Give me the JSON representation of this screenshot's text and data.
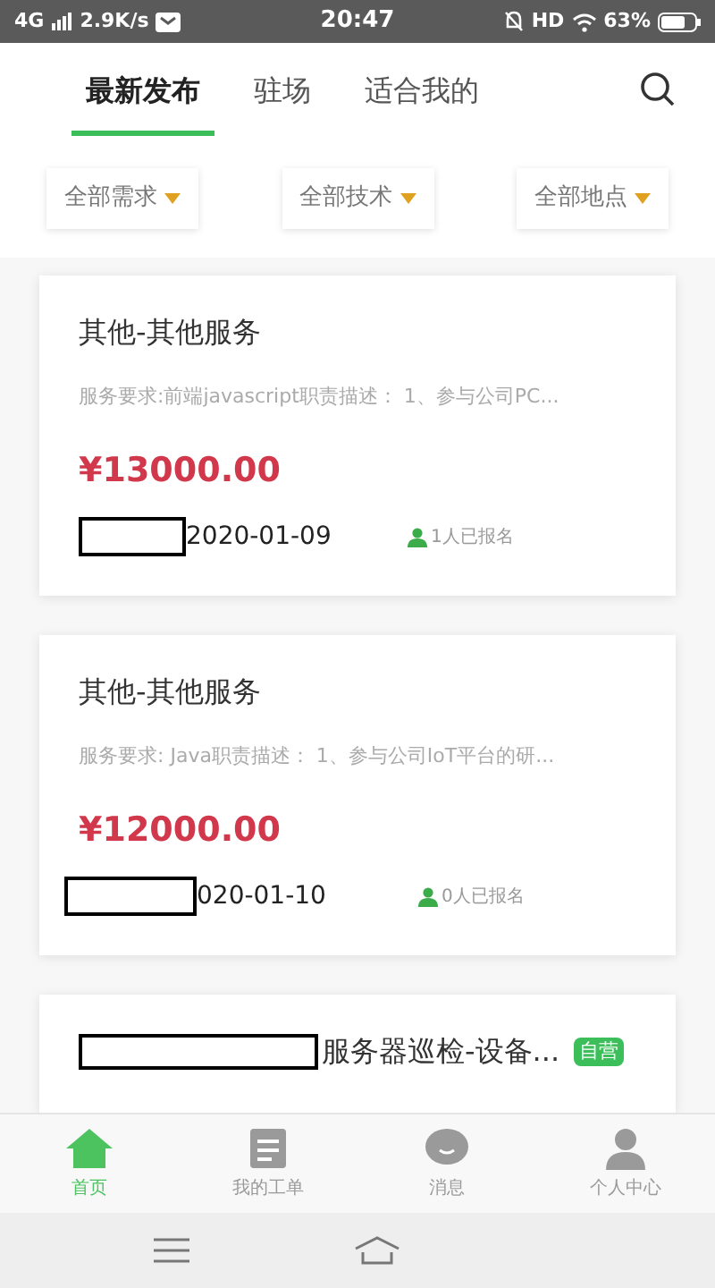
{
  "status_bar": {
    "network": "4G",
    "speed": "2.9K/s",
    "time": "20:47",
    "hd": "HD",
    "battery": "63%"
  },
  "tabs": [
    {
      "label": "最新发布",
      "selected": true
    },
    {
      "label": "驻场",
      "selected": false
    },
    {
      "label": "适合我的",
      "selected": false
    }
  ],
  "filters": [
    "全部需求",
    "全部技术",
    "全部地点"
  ],
  "cards": [
    {
      "title": "其他-其他服务",
      "description": "服务要求:前端javascript职责描述： 1、参与公司PC...",
      "price": "¥13000.00",
      "date": "2020-01-09",
      "signups": "1人已报名"
    },
    {
      "title": "其他-其他服务",
      "description": "服务要求: Java职责描述： 1、参与公司IoT平台的研...",
      "price": "¥12000.00",
      "date": "020-01-10",
      "signups": "0人已报名"
    },
    {
      "title": "服务器巡检-设备...",
      "badge": "自营"
    }
  ],
  "bottom_nav": [
    {
      "label": "首页",
      "kind": "home",
      "selected": true
    },
    {
      "label": "我的工单",
      "kind": "orders",
      "selected": false
    },
    {
      "label": "消息",
      "kind": "messages",
      "selected": false
    },
    {
      "label": "个人中心",
      "kind": "profile",
      "selected": false
    }
  ]
}
